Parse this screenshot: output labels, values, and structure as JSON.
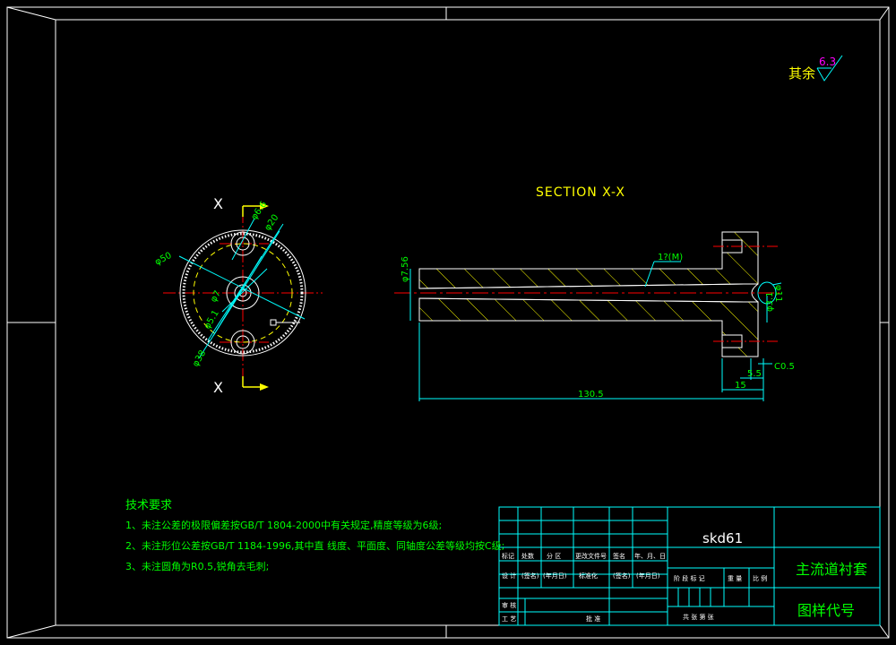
{
  "roughness": {
    "prefix": "其余",
    "value": "6.3"
  },
  "section_title": "SECTION X-X",
  "section_markers": {
    "top": "X",
    "bottom": "X"
  },
  "front_view_dims": {
    "phi50": "φ50",
    "phi20": "φ20",
    "phi6_6": "φ6.6",
    "phi7": "φ7",
    "phi5_1": "φ5.1",
    "phi38": "φ38"
  },
  "section_view_dims": {
    "phi7_56": "φ7.56",
    "taper": "1?(M)",
    "phi11": "φ11",
    "phi3_1": "φ3.1",
    "d5_5": "5.5",
    "c0_5": "C0.5",
    "len15": "15",
    "len130_5": "130.5"
  },
  "notes": {
    "heading": "技术要求",
    "lines": [
      "1、未注公差的极限偏差按GB/T 1804-2000中有关规定,精度等级为6级;",
      "2、未注形位公差按GB/T 1184-1996,其中直 线度、平面度、同轴度公差等级均按C级;",
      "3、未注圆角为R0.5,锐角去毛刺;"
    ]
  },
  "title_block": {
    "material": "skd61",
    "part_name": "主流道衬套",
    "drawing_code": "图样代号",
    "header_row": [
      "标记",
      "处数",
      "分 区",
      "更改文件号",
      "签名",
      "年、月、日"
    ],
    "design_row": [
      "设 计",
      "(签名)",
      "(年月日)",
      "标准化",
      "(签名)",
      "(年月日)"
    ],
    "stage_labels": [
      "阶 段 标 记",
      "重 量",
      "比 例"
    ],
    "review": "审 核",
    "process": "工 艺",
    "approve": "批 准",
    "sheet_row": "共 张 第 张"
  },
  "colors": {
    "frame": "#ffffff",
    "dimension": "#00ff00",
    "centerline": "#ff0000",
    "section_line": "#ffffff",
    "hatch": "#ffff00",
    "leader": "#00ffff",
    "title_block": "#00ffff",
    "note_text": "#00ff00",
    "roughness_value": "#ff00ff",
    "section_title": "#ffff00"
  }
}
